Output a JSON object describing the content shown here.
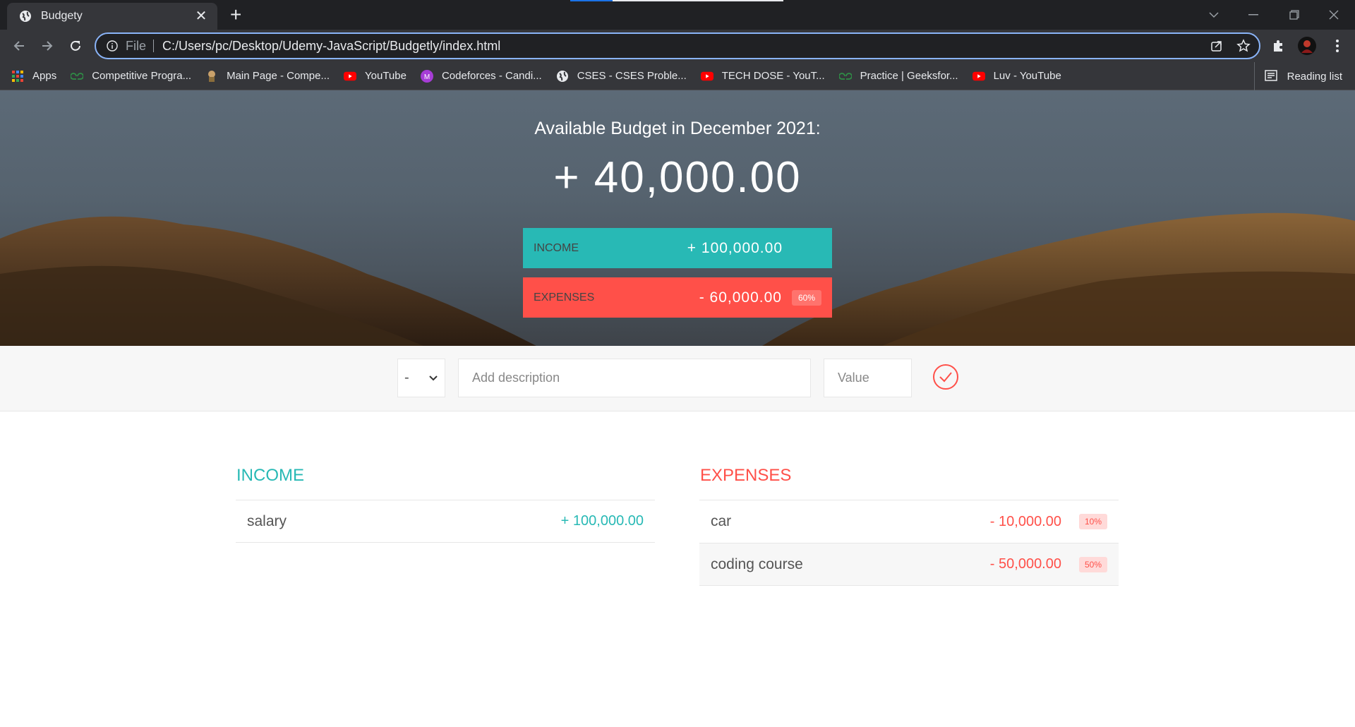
{
  "browser": {
    "tab_title": "Budgety",
    "omnibox_scheme": "File",
    "url": "C:/Users/pc/Desktop/Udemy-JavaScript/Budgetly/index.html",
    "bookmarks": [
      {
        "label": "Apps",
        "icon": "apps-grid-icon"
      },
      {
        "label": "Competitive Progra...",
        "icon": "geeksforgeeks-icon"
      },
      {
        "label": "Main Page - Compe...",
        "icon": "wiki-icon"
      },
      {
        "label": "YouTube",
        "icon": "youtube-icon"
      },
      {
        "label": "Codeforces - Candi...",
        "icon": "codeforces-icon"
      },
      {
        "label": "CSES - CSES Proble...",
        "icon": "globe-icon"
      },
      {
        "label": "TECH DOSE - YouT...",
        "icon": "youtube-icon"
      },
      {
        "label": "Practice | Geeksfor...",
        "icon": "geeksforgeeks-icon"
      },
      {
        "label": "Luv - YouTube",
        "icon": "youtube-icon"
      }
    ],
    "reading_list": "Reading list"
  },
  "budget": {
    "title": "Available Budget in December 2021:",
    "value": "+ 40,000.00",
    "income_label": "INCOME",
    "income_value": "+ 100,000.00",
    "expenses_label": "EXPENSES",
    "expenses_value": "- 60,000.00",
    "expenses_percent": "60%"
  },
  "add": {
    "type_value": "-",
    "desc_placeholder": "Add description",
    "value_placeholder": "Value"
  },
  "income": {
    "title": "INCOME",
    "items": [
      {
        "description": "salary",
        "value": "+ 100,000.00"
      }
    ]
  },
  "expenses": {
    "title": "EXPENSES",
    "items": [
      {
        "description": "car",
        "value": "- 10,000.00",
        "percent": "10%"
      },
      {
        "description": "coding course",
        "value": "- 50,000.00",
        "percent": "50%"
      }
    ]
  },
  "colors": {
    "income": "#28b9b5",
    "expenses": "#ff5049",
    "chrome_dark": "#202124",
    "chrome_toolbar": "#35363a"
  }
}
